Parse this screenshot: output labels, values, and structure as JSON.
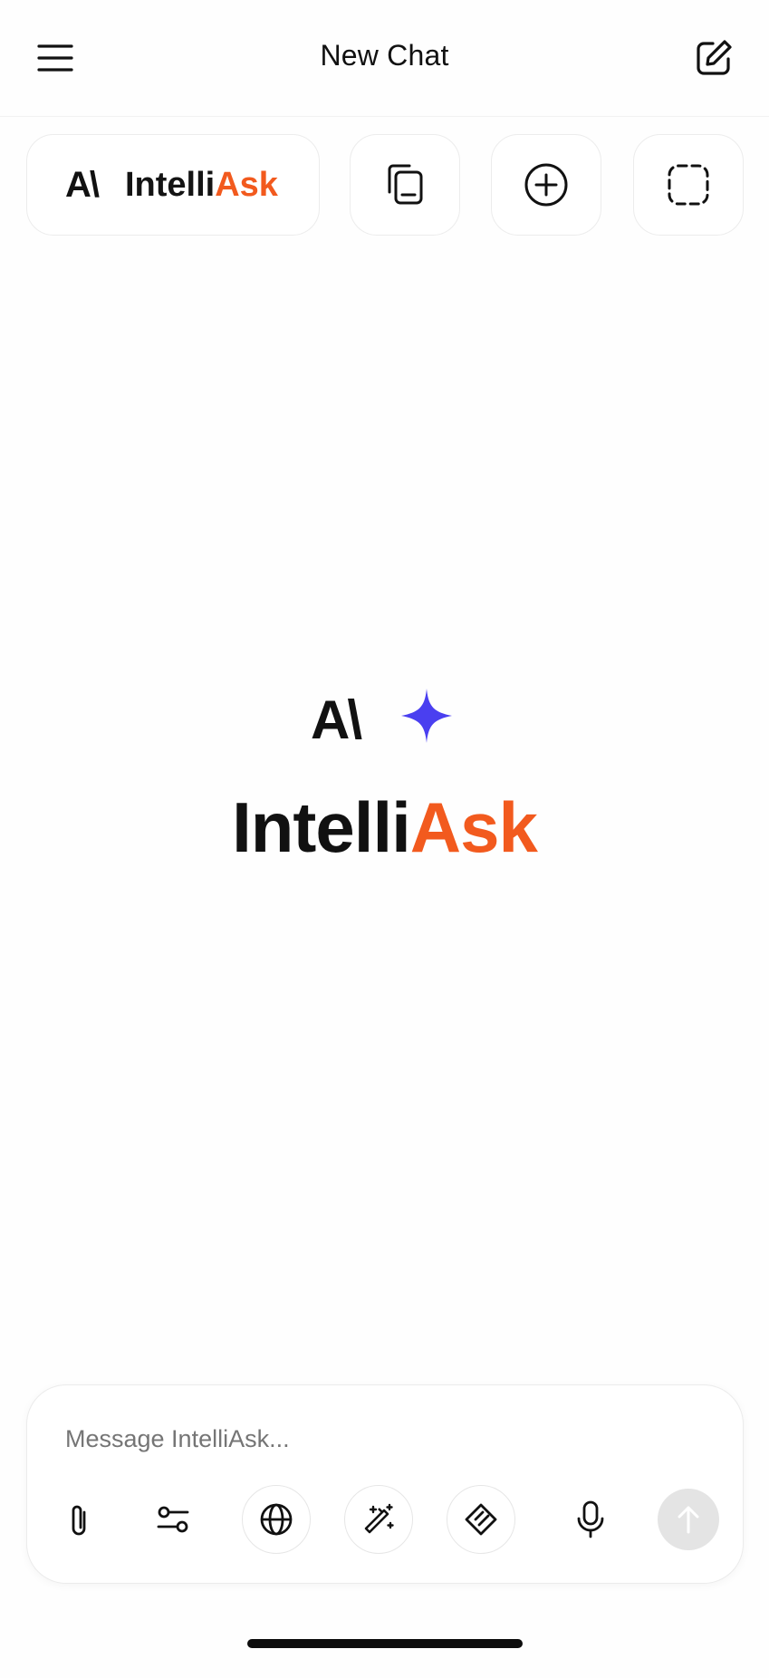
{
  "header": {
    "title": "New Chat",
    "menu_icon": "hamburger-menu-icon",
    "compose_icon": "edit-square-icon"
  },
  "quick_actions": {
    "brand_mark": "A\\",
    "brand_name_part1": "Intelli",
    "brand_name_part2": "Ask",
    "items": [
      {
        "icon": "copy-device-icon"
      },
      {
        "icon": "plus-circle-icon"
      },
      {
        "icon": "dashed-square-select-icon"
      }
    ]
  },
  "hero": {
    "mark": "A\\",
    "spark_icon": "sparkle-icon",
    "title_part1": "Intelli",
    "title_part2": "Ask"
  },
  "composer": {
    "placeholder": "Message IntelliAsk...",
    "tools": [
      {
        "icon": "paperclip-icon"
      },
      {
        "icon": "sliders-icon"
      },
      {
        "icon": "globe-icon"
      },
      {
        "icon": "magic-wand-icon"
      },
      {
        "icon": "layers-icon"
      },
      {
        "icon": "microphone-icon"
      },
      {
        "icon": "send-arrow-up-icon"
      }
    ]
  },
  "colors": {
    "accent_orange": "#f25a1e",
    "spark_blue": "#4a3ff0",
    "text": "#111111"
  }
}
